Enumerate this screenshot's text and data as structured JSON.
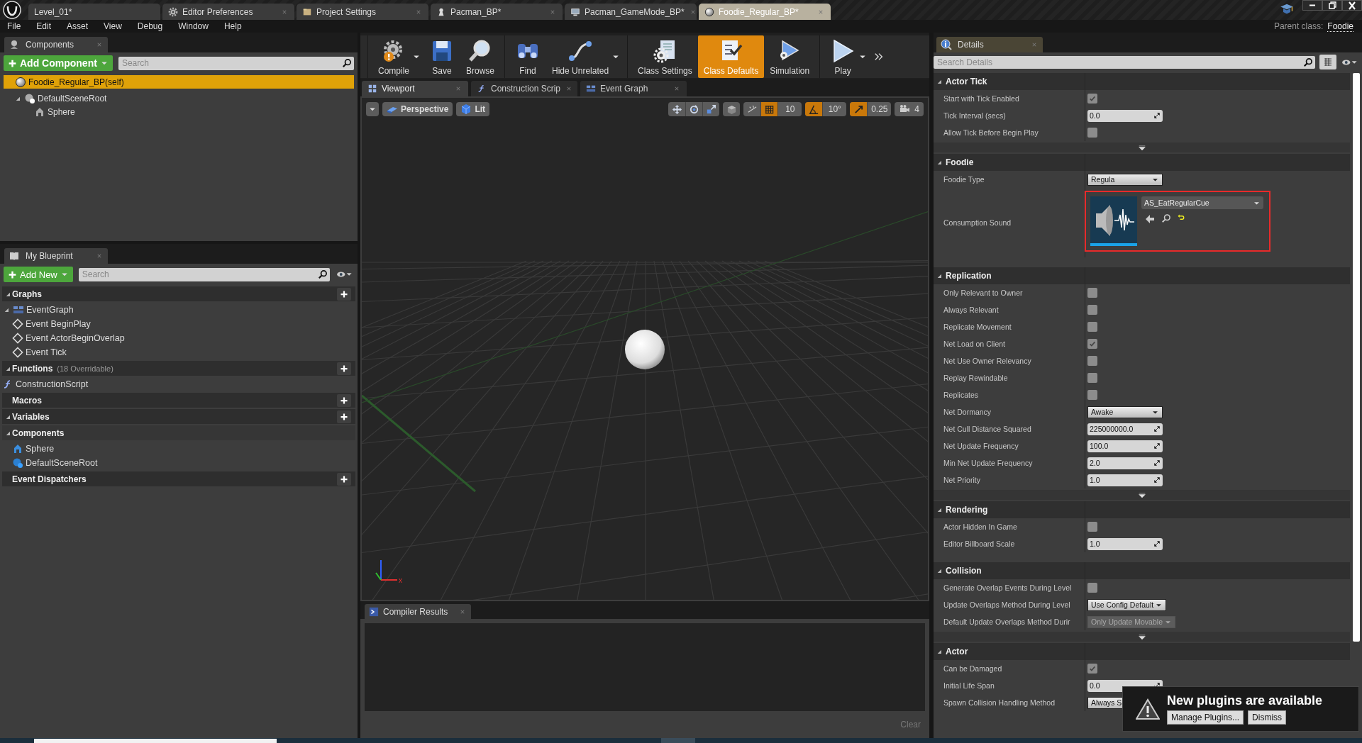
{
  "editor_tabs": [
    {
      "label": "Level_01*",
      "kind": "level",
      "selected": false
    },
    {
      "label": "Editor Preferences",
      "kind": "preferences",
      "selected": false
    },
    {
      "label": "Project Settings",
      "kind": "project",
      "selected": false
    },
    {
      "label": "Pacman_BP*",
      "kind": "blueprint",
      "selected": false
    },
    {
      "label": "Pacman_GameMode_BP*",
      "kind": "gamemode",
      "selected": false
    },
    {
      "label": "Foodie_Regular_BP*",
      "kind": "sphere",
      "selected": true
    }
  ],
  "menu": [
    "File",
    "Edit",
    "Asset",
    "View",
    "Debug",
    "Window",
    "Help"
  ],
  "parent_class": {
    "label": "Parent class:",
    "value": "Foodie"
  },
  "components_panel": {
    "tab": "Components",
    "add_button": "Add Component",
    "search": {
      "placeholder": "Search"
    },
    "tree": [
      {
        "label": "Foodie_Regular_BP(self)",
        "kind": "self",
        "selected": true
      },
      {
        "label": "DefaultSceneRoot",
        "kind": "scene_root",
        "selected": false,
        "expanded": true,
        "children": [
          {
            "label": "Sphere",
            "kind": "mesh",
            "selected": false
          }
        ]
      }
    ]
  },
  "my_blueprint": {
    "tab": "My Blueprint",
    "add_button": "Add New",
    "search": {
      "placeholder": "Search"
    },
    "sections": [
      {
        "title": "Graphs",
        "kind": "category",
        "expanded": true,
        "items": [
          {
            "label": "EventGraph",
            "kind": "graph",
            "expanded": true,
            "children": [
              {
                "label": "Event BeginPlay",
                "kind": "event"
              },
              {
                "label": "Event ActorBeginOverlap",
                "kind": "event"
              },
              {
                "label": "Event Tick",
                "kind": "event"
              }
            ]
          }
        ]
      },
      {
        "title": "Functions",
        "note": "(18 Overridable)",
        "kind": "category",
        "expanded": true,
        "items": [
          {
            "label": "ConstructionScript",
            "kind": "function"
          }
        ]
      },
      {
        "title": "Macros",
        "kind": "category"
      },
      {
        "title": "Variables",
        "kind": "category",
        "expanded": true
      },
      {
        "title": "Components",
        "kind": "subcategory",
        "expanded": true,
        "items": [
          {
            "label": "Sphere",
            "kind": "mesh"
          },
          {
            "label": "DefaultSceneRoot",
            "kind": "scene_root"
          }
        ]
      },
      {
        "title": "Event Dispatchers",
        "kind": "category"
      }
    ]
  },
  "toolbar": [
    {
      "label": "Compile",
      "kind": "compile",
      "dropdown": true,
      "selected": false
    },
    {
      "label": "Save",
      "kind": "save",
      "selected": false
    },
    {
      "label": "Browse",
      "kind": "browse",
      "selected": false
    },
    {
      "label": "Find",
      "kind": "find",
      "selected": false
    },
    {
      "label": "Hide Unrelated",
      "kind": "hide",
      "dropdown": true,
      "selected": false
    },
    {
      "label": "Class Settings",
      "kind": "class_settings",
      "selected": false
    },
    {
      "label": "Class Defaults",
      "kind": "class_defaults",
      "selected": true
    },
    {
      "label": "Simulation",
      "kind": "simulation",
      "selected": false
    },
    {
      "label": "Play",
      "kind": "play",
      "dropdown": true,
      "selected": false
    }
  ],
  "view_tabs": [
    {
      "label": "Viewport",
      "kind": "viewport",
      "selected": true
    },
    {
      "label": "Construction Scrip",
      "kind": "function",
      "selected": false
    },
    {
      "label": "Event Graph",
      "kind": "graph",
      "selected": false
    }
  ],
  "viewport": {
    "view_mode": "Perspective",
    "lighting": "Lit",
    "axis_label": "x",
    "snaps": [
      {
        "kind": "grid",
        "on": true,
        "value": "10"
      },
      {
        "kind": "rotation",
        "on": true,
        "value": "10°"
      },
      {
        "kind": "scale",
        "on": true,
        "value": "0.25"
      }
    ],
    "camera_speed": "4"
  },
  "compiler_results": {
    "tab": "Compiler Results",
    "clear": "Clear"
  },
  "details": {
    "tab": "Details",
    "search": {
      "placeholder": "Search Details"
    },
    "sections": [
      {
        "title": "Actor Tick",
        "expanded": true,
        "advanced": true,
        "rows": [
          {
            "label": "Start with Tick Enabled",
            "kind": "checkbox",
            "checked": true
          },
          {
            "label": "Tick Interval (secs)",
            "kind": "number",
            "value": "0.0"
          },
          {
            "label": "Allow Tick Before Begin Play",
            "kind": "checkbox",
            "checked": false
          }
        ]
      },
      {
        "title": "Foodie",
        "expanded": true,
        "advanced": false,
        "rows": [
          {
            "label": "Foodie Type",
            "kind": "dropdown",
            "value": "Regula",
            "disabled": false
          },
          {
            "label": "Consumption Sound",
            "kind": "asset",
            "value": "AS_EatRegularCue",
            "highlighted": true
          }
        ]
      },
      {
        "title": "Replication",
        "expanded": true,
        "advanced": true,
        "rows": [
          {
            "label": "Only Relevant to Owner",
            "kind": "checkbox",
            "checked": false
          },
          {
            "label": "Always Relevant",
            "kind": "checkbox",
            "checked": false
          },
          {
            "label": "Replicate Movement",
            "kind": "checkbox",
            "checked": false
          },
          {
            "label": "Net Load on Client",
            "kind": "checkbox",
            "checked": true
          },
          {
            "label": "Net Use Owner Relevancy",
            "kind": "checkbox",
            "checked": false
          },
          {
            "label": "Replay Rewindable",
            "kind": "checkbox",
            "checked": false
          },
          {
            "label": "Replicates",
            "kind": "checkbox",
            "checked": false
          },
          {
            "label": "Net Dormancy",
            "kind": "dropdown",
            "value": "Awake",
            "disabled": false
          },
          {
            "label": "Net Cull Distance Squared",
            "kind": "number",
            "value": "225000000.0"
          },
          {
            "label": "Net Update Frequency",
            "kind": "number",
            "value": "100.0"
          },
          {
            "label": "Min Net Update Frequency",
            "kind": "number",
            "value": "2.0"
          },
          {
            "label": "Net Priority",
            "kind": "number",
            "value": "1.0"
          }
        ]
      },
      {
        "title": "Rendering",
        "expanded": true,
        "advanced": false,
        "rows": [
          {
            "label": "Actor Hidden In Game",
            "kind": "checkbox",
            "checked": false
          },
          {
            "label": "Editor Billboard Scale",
            "kind": "number",
            "value": "1.0"
          }
        ]
      },
      {
        "title": "Collision",
        "expanded": true,
        "advanced": true,
        "rows": [
          {
            "label": "Generate Overlap Events During Level",
            "kind": "checkbox",
            "checked": false
          },
          {
            "label": "Update Overlaps Method During Level",
            "kind": "dropdown",
            "value": "Use Config Default",
            "disabled": false
          },
          {
            "label": "Default Update Overlaps Method Durir",
            "kind": "dropdown",
            "value": "Only Update Movable",
            "disabled": true
          }
        ]
      },
      {
        "title": "Actor",
        "expanded": true,
        "advanced": false,
        "rows": [
          {
            "label": "Can be Damaged",
            "kind": "checkbox",
            "checked": true
          },
          {
            "label": "Initial Life Span",
            "kind": "number",
            "value": "0.0"
          },
          {
            "label": "Spawn Collision Handling Method",
            "kind": "dropdown",
            "value": "Always S",
            "disabled": false,
            "covered": true
          }
        ]
      }
    ]
  },
  "notification": {
    "title": "New plugins are available",
    "buttons": [
      "Manage Plugins...",
      "Dismiss"
    ]
  }
}
